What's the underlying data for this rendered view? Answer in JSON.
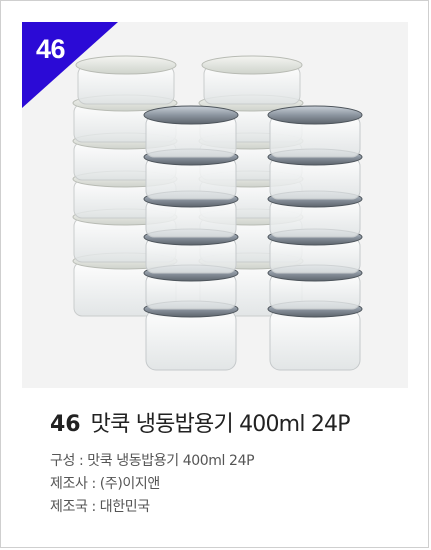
{
  "badge": {
    "number": "46"
  },
  "product": {
    "number": "46",
    "title": "맛쿡 냉동밥용기 400ml 24P"
  },
  "specs": [
    {
      "label": "구성",
      "value": "맛쿡 냉동밥용기 400ml 24P"
    },
    {
      "label": "제조사",
      "value": "(주)이지앤"
    },
    {
      "label": "제조국",
      "value": "대한민국"
    }
  ],
  "colors": {
    "badge": "#2b0ad6",
    "frame_bg": "#f3f3f3",
    "lid_clear": "#dfe3e0",
    "lid_dark": "#5d646c"
  },
  "photo": {
    "subject": "stacked clear food storage containers with lids",
    "back_stacks": 2,
    "front_stacks": 2,
    "containers_per_stack": 6
  }
}
